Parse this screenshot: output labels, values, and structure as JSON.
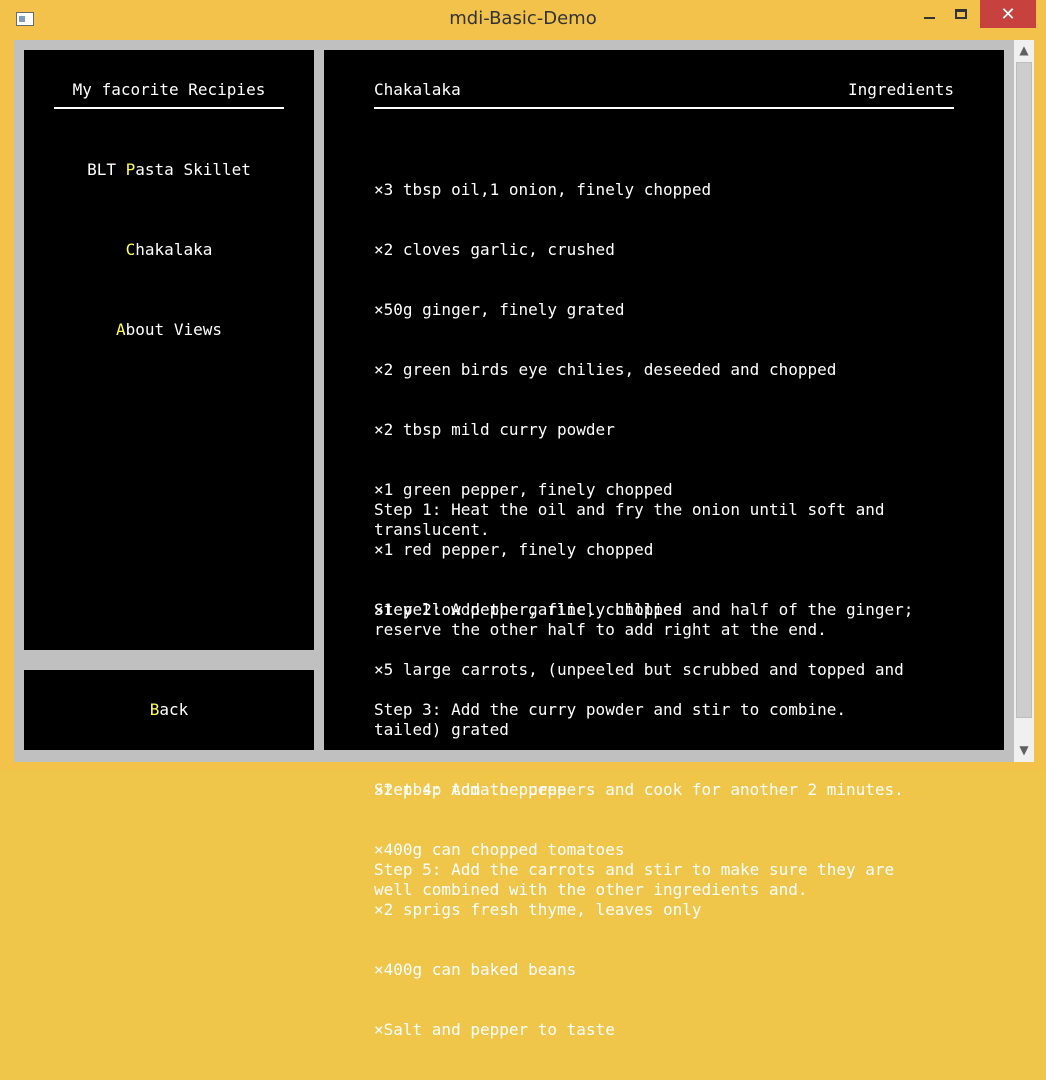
{
  "window": {
    "title": "mdi-Basic-Demo",
    "icons": {
      "app": "app-window-icon",
      "minimize": "minimize-icon",
      "maximize": "maximize-icon",
      "close": "close-icon"
    },
    "close_glyph": "✕"
  },
  "sidebar": {
    "title": "My facorite Recipies",
    "items": [
      {
        "hotkey": "",
        "hot": "",
        "rest": "",
        "prefix": "BLT ",
        "hot_letter": "P",
        "suffix": "asta Skillet"
      },
      {
        "prefix": "",
        "hot_letter": "C",
        "suffix": "hakalaka"
      },
      {
        "prefix": "",
        "hot_letter": "A",
        "suffix": "bout Views"
      }
    ]
  },
  "back": {
    "prefix": "",
    "hot_letter": "B",
    "suffix": "ack"
  },
  "recipe": {
    "title": "Chakalaka",
    "tab": "Ingredients",
    "ingredients": [
      "×3 tbsp oil,1 onion, finely chopped",
      "×2 cloves garlic, crushed",
      "×50g ginger, finely grated",
      "×2 green birds eye chilies, deseeded and chopped",
      "×2 tbsp mild curry powder",
      "×1 green pepper, finely chopped",
      "×1 red pepper, finely chopped",
      "×1 yellow pepper, finely chopped",
      "×5 large carrots, (unpeeled but scrubbed and topped and",
      "tailed) grated",
      "×2 tbsp tomato puree",
      "×400g can chopped tomatoes",
      "×2 sprigs fresh thyme, leaves only",
      "×400g can baked beans",
      "×Salt and pepper to taste"
    ],
    "steps": [
      "Step 1: Heat the oil and fry the onion until soft and\ntranslucent.",
      "Step 2: Add the garlic, chillies and half of the ginger;\nreserve the other half to add right at the end.",
      "Step 3: Add the curry powder and stir to combine.",
      "Step 4: Add the peppers and cook for another 2 minutes.",
      "Step 5: Add the carrots and stir to make sure they are\nwell combined with the other ingredients and."
    ]
  },
  "scrollbar": {
    "up_glyph": "▲",
    "down_glyph": "▼",
    "icons": {
      "up": "chevron-up-icon",
      "down": "chevron-down-icon"
    }
  },
  "colors": {
    "frame": "#f2c24b",
    "panel": "#000000",
    "text": "#ffffff",
    "hotkey": "#ffff55",
    "client": "#c0c0c0",
    "close": "#c7423f"
  }
}
